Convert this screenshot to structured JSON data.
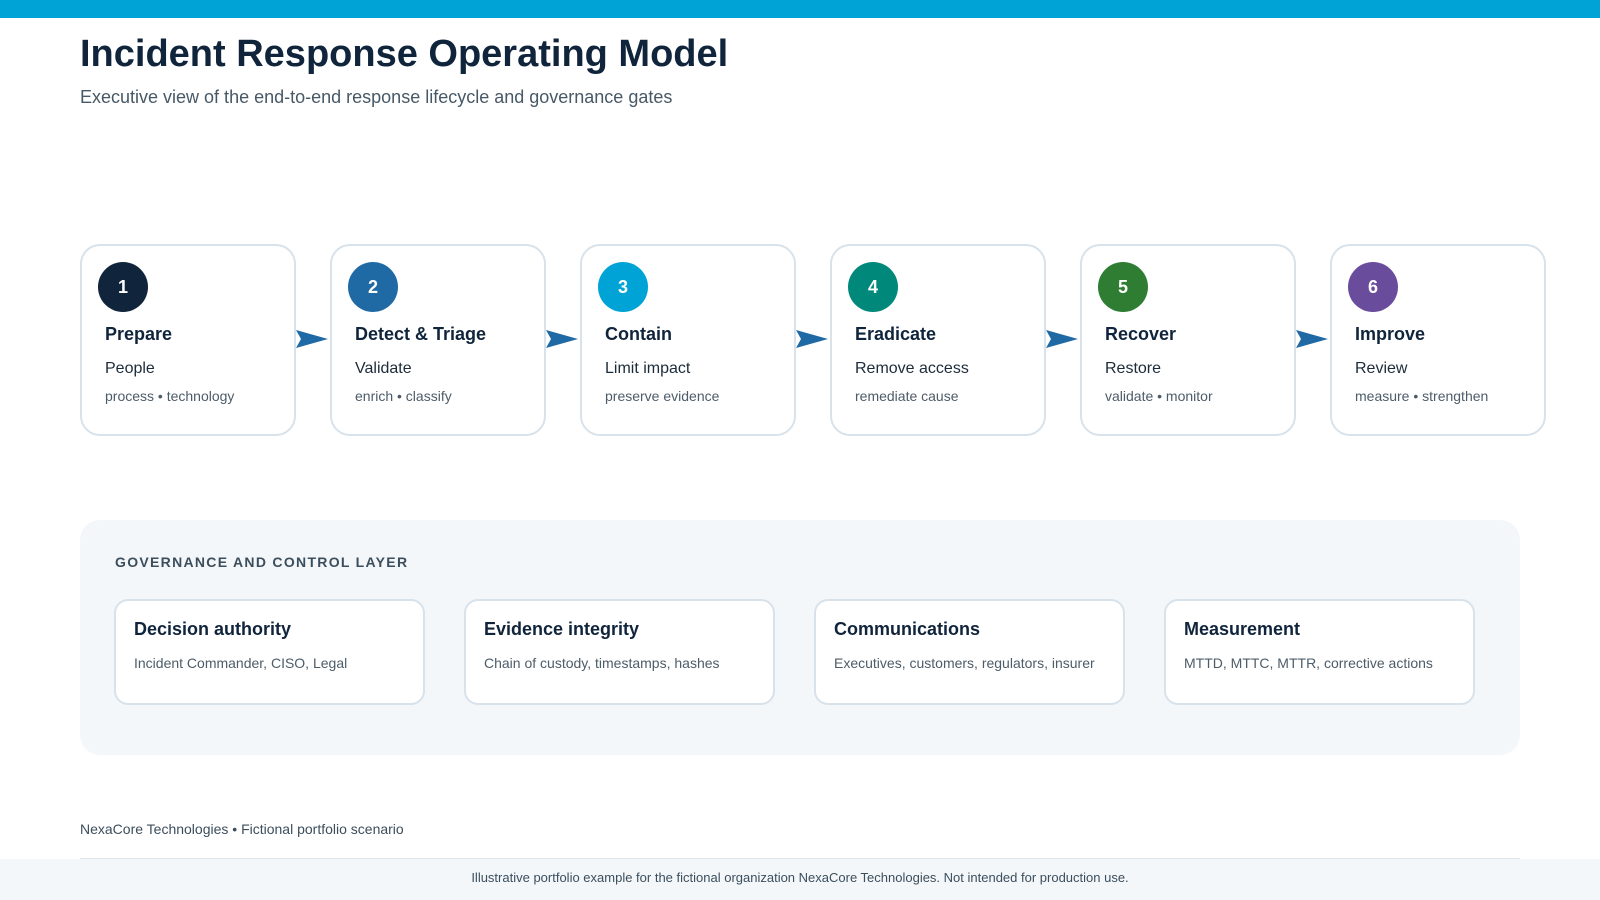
{
  "header": {
    "title": "Incident Response Operating Model",
    "subtitle": "Executive view of the end-to-end response lifecycle and governance gates"
  },
  "colors": {
    "top_bar": "#00a3d6",
    "arrow": "#1f6aa5",
    "stage_1": "#10243b",
    "stage_2": "#1f6aa5",
    "stage_3": "#00a3d6",
    "stage_4": "#00897b",
    "stage_5": "#2e7d32",
    "stage_6": "#6a4c9c"
  },
  "stages": [
    {
      "number": "1",
      "title": "Prepare",
      "primary": "People",
      "secondary": "process • technology"
    },
    {
      "number": "2",
      "title": "Detect & Triage",
      "primary": "Validate",
      "secondary": "enrich • classify"
    },
    {
      "number": "3",
      "title": "Contain",
      "primary": "Limit impact",
      "secondary": "preserve evidence"
    },
    {
      "number": "4",
      "title": "Eradicate",
      "primary": "Remove access",
      "secondary": "remediate cause"
    },
    {
      "number": "5",
      "title": "Recover",
      "primary": "Restore",
      "secondary": "validate • monitor"
    },
    {
      "number": "6",
      "title": "Improve",
      "primary": "Review",
      "secondary": "measure • strengthen"
    }
  ],
  "governance": {
    "heading": "GOVERNANCE AND CONTROL LAYER",
    "cards": [
      {
        "title": "Decision authority",
        "text": "Incident Commander, CISO, Legal"
      },
      {
        "title": "Evidence integrity",
        "text": "Chain of custody, timestamps, hashes"
      },
      {
        "title": "Communications",
        "text": "Executives, customers, regulators, insurer"
      },
      {
        "title": "Measurement",
        "text": "MTTD, MTTC, MTTR, corrective actions"
      }
    ]
  },
  "footer": {
    "org_note": "NexaCore Technologies • Fictional portfolio scenario",
    "disclaimer": "Illustrative portfolio example for the fictional organization NexaCore Technologies. Not intended for production use."
  }
}
